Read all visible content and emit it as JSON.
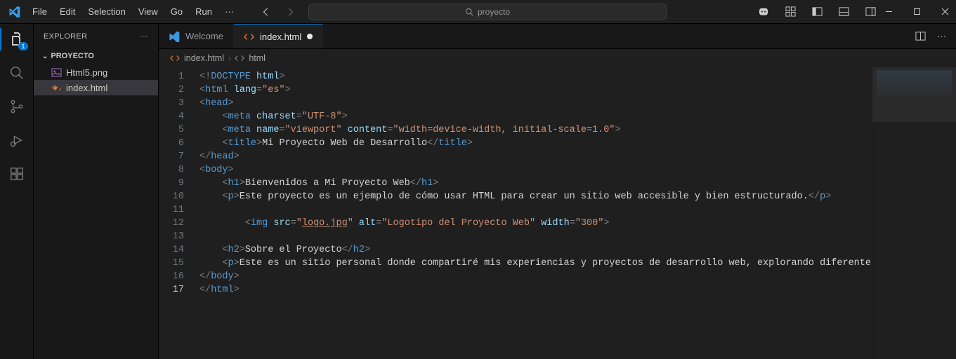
{
  "menus": [
    "File",
    "Edit",
    "Selection",
    "View",
    "Go",
    "Run",
    "···"
  ],
  "search_placeholder": "proyecto",
  "sidebar": {
    "title": "EXPLORER",
    "folder": "PROYECTO",
    "files": [
      {
        "name": "Html5.png",
        "kind": "image"
      },
      {
        "name": "index.html",
        "kind": "html",
        "selected": true
      }
    ]
  },
  "tabs": [
    {
      "label": "Welcome",
      "kind": "welcome",
      "active": false
    },
    {
      "label": "index.html",
      "kind": "html",
      "active": true,
      "dirty": true
    }
  ],
  "breadcrumbs": [
    {
      "label": "index.html",
      "kind": "html"
    },
    {
      "label": "html",
      "kind": "element"
    }
  ],
  "activity_badge": "1",
  "code": {
    "current_line": 17,
    "lines": [
      {
        "n": 1,
        "tokens": [
          [
            "gray",
            "<!"
          ],
          [
            "doctype",
            "DOCTYPE"
          ],
          [
            "text",
            " "
          ],
          [
            "attr",
            "html"
          ],
          [
            "gray",
            ">"
          ]
        ]
      },
      {
        "n": 2,
        "tokens": [
          [
            "gray",
            "<"
          ],
          [
            "tag",
            "html"
          ],
          [
            "text",
            " "
          ],
          [
            "attr",
            "lang"
          ],
          [
            "gray",
            "="
          ],
          [
            "str",
            "\"es\""
          ],
          [
            "gray",
            ">"
          ]
        ]
      },
      {
        "n": 3,
        "tokens": [
          [
            "gray",
            "<"
          ],
          [
            "tag",
            "head"
          ],
          [
            "gray",
            ">"
          ]
        ]
      },
      {
        "n": 4,
        "indent": 1,
        "tokens": [
          [
            "gray",
            "    <"
          ],
          [
            "tag",
            "meta"
          ],
          [
            "text",
            " "
          ],
          [
            "attr",
            "charset"
          ],
          [
            "gray",
            "="
          ],
          [
            "str",
            "\"UTF-8\""
          ],
          [
            "gray",
            ">"
          ]
        ]
      },
      {
        "n": 5,
        "indent": 1,
        "tokens": [
          [
            "gray",
            "    <"
          ],
          [
            "tag",
            "meta"
          ],
          [
            "text",
            " "
          ],
          [
            "attr",
            "name"
          ],
          [
            "gray",
            "="
          ],
          [
            "str",
            "\"viewport\""
          ],
          [
            "text",
            " "
          ],
          [
            "attr",
            "content"
          ],
          [
            "gray",
            "="
          ],
          [
            "str",
            "\"width=device-width, initial-scale=1.0\""
          ],
          [
            "gray",
            ">"
          ]
        ]
      },
      {
        "n": 6,
        "indent": 1,
        "tokens": [
          [
            "gray",
            "    <"
          ],
          [
            "tag",
            "title"
          ],
          [
            "gray",
            ">"
          ],
          [
            "text",
            "Mi Proyecto Web de Desarrollo"
          ],
          [
            "gray",
            "</"
          ],
          [
            "tag",
            "title"
          ],
          [
            "gray",
            ">"
          ]
        ]
      },
      {
        "n": 7,
        "tokens": [
          [
            "gray",
            "</"
          ],
          [
            "tag",
            "head"
          ],
          [
            "gray",
            ">"
          ]
        ]
      },
      {
        "n": 8,
        "tokens": [
          [
            "gray",
            "<"
          ],
          [
            "tag",
            "body"
          ],
          [
            "gray",
            ">"
          ]
        ]
      },
      {
        "n": 9,
        "indent": 1,
        "tokens": [
          [
            "gray",
            "    <"
          ],
          [
            "tag",
            "h1"
          ],
          [
            "gray",
            ">"
          ],
          [
            "text",
            "Bienvenidos a Mi Proyecto Web"
          ],
          [
            "gray",
            "</"
          ],
          [
            "tag",
            "h1"
          ],
          [
            "gray",
            ">"
          ]
        ]
      },
      {
        "n": 10,
        "indent": 1,
        "tokens": [
          [
            "gray",
            "    <"
          ],
          [
            "tag",
            "p"
          ],
          [
            "gray",
            ">"
          ],
          [
            "text",
            "Este proyecto es un ejemplo de cómo usar HTML para crear un sitio web accesible y bien estructurado."
          ],
          [
            "gray",
            "</"
          ],
          [
            "tag",
            "p"
          ],
          [
            "gray",
            ">"
          ]
        ]
      },
      {
        "n": 11,
        "indent": 1,
        "tokens": [
          [
            "text",
            "    "
          ]
        ]
      },
      {
        "n": 12,
        "indent": 2,
        "tokens": [
          [
            "gray",
            "        <"
          ],
          [
            "tag",
            "img"
          ],
          [
            "text",
            " "
          ],
          [
            "attr",
            "src"
          ],
          [
            "gray",
            "="
          ],
          [
            "str",
            "\""
          ],
          [
            "link",
            "logo.jpg"
          ],
          [
            "str",
            "\""
          ],
          [
            "text",
            " "
          ],
          [
            "attr",
            "alt"
          ],
          [
            "gray",
            "="
          ],
          [
            "str",
            "\"Logotipo del Proyecto Web\""
          ],
          [
            "text",
            " "
          ],
          [
            "attr",
            "width"
          ],
          [
            "gray",
            "="
          ],
          [
            "str",
            "\"300\""
          ],
          [
            "gray",
            ">"
          ]
        ]
      },
      {
        "n": 13,
        "indent": 1,
        "tokens": [
          [
            "text",
            "    "
          ]
        ]
      },
      {
        "n": 14,
        "indent": 1,
        "tokens": [
          [
            "gray",
            "    <"
          ],
          [
            "tag",
            "h2"
          ],
          [
            "gray",
            ">"
          ],
          [
            "text",
            "Sobre el Proyecto"
          ],
          [
            "gray",
            "</"
          ],
          [
            "tag",
            "h2"
          ],
          [
            "gray",
            ">"
          ]
        ]
      },
      {
        "n": 15,
        "indent": 1,
        "tokens": [
          [
            "gray",
            "    <"
          ],
          [
            "tag",
            "p"
          ],
          [
            "gray",
            ">"
          ],
          [
            "text",
            "Este es un sitio personal donde compartiré mis experiencias y proyectos de desarrollo web, explorando diferentes te"
          ]
        ]
      },
      {
        "n": 16,
        "tokens": [
          [
            "gray",
            "</"
          ],
          [
            "tag",
            "body"
          ],
          [
            "gray",
            ">"
          ]
        ]
      },
      {
        "n": 17,
        "tokens": [
          [
            "gray",
            "</"
          ],
          [
            "tag",
            "html"
          ],
          [
            "gray",
            ">"
          ]
        ]
      }
    ]
  }
}
